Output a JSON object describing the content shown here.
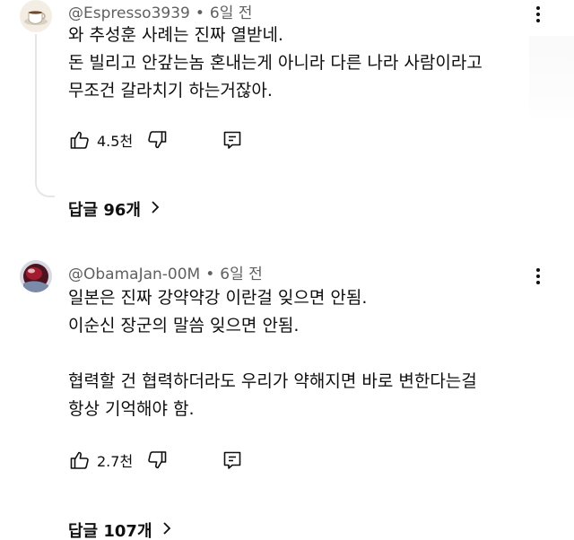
{
  "comments": [
    {
      "author": "@Espresso3939",
      "time": "6일 전",
      "lines": [
        "와 추성훈 사례는 진짜 열받네.",
        "돈 빌리고 안갚는놈 혼내는게 아니라 다른 나라 사람이라고",
        "무조건 갈라치기 하는거잖아."
      ],
      "likes": "4.5천",
      "replies": "답글 96개"
    },
    {
      "author": "@ObamaJan-00M",
      "time": "6일 전",
      "lines": [
        "일본은 진짜 강약약강 이란걸 잊으면 안됨.",
        "이순신 장군의 말씀 잊으면 안됨.",
        "",
        "협력할 건 협력하더라도 우리가 약해지면 바로 변한다는걸",
        "항상 기억해야 함."
      ],
      "likes": "2.7천",
      "replies": "답글 107개"
    }
  ],
  "icons": {
    "like": "thumbs-up-icon",
    "dislike": "thumbs-down-icon",
    "reply": "reply-icon",
    "more": "more-vert-icon",
    "chevron": "chevron-right-icon"
  }
}
